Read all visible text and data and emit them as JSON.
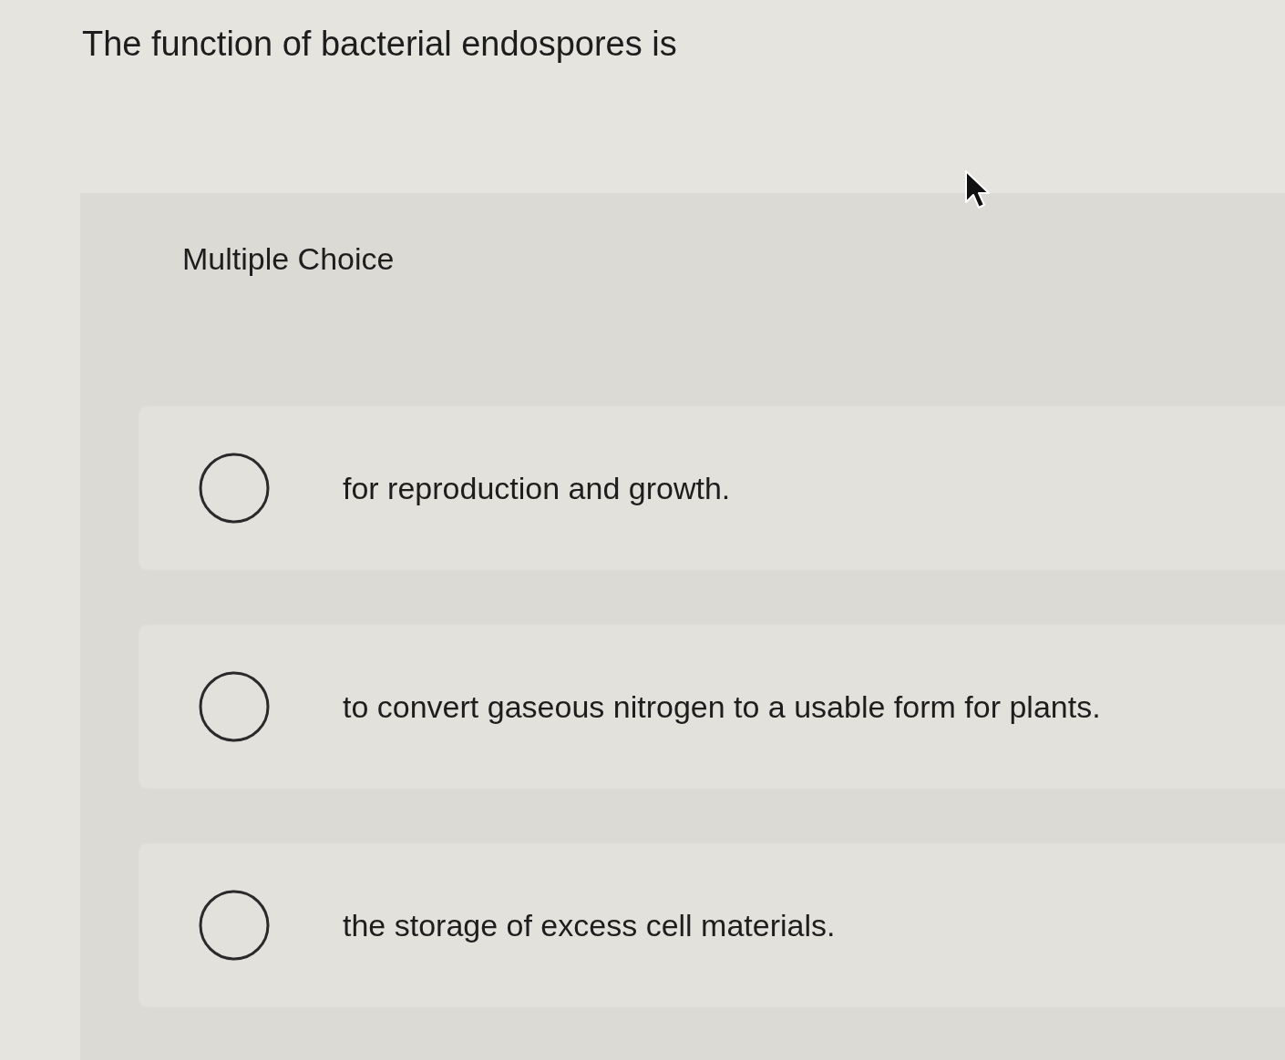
{
  "question": {
    "text": "The function of bacterial endospores is"
  },
  "answer_panel": {
    "heading": "Multiple Choice",
    "options": [
      {
        "text": "for reproduction and growth.",
        "selected": false
      },
      {
        "text": "to convert gaseous nitrogen to a usable form for plants.",
        "selected": false
      },
      {
        "text": "the storage of excess cell materials.",
        "selected": false
      }
    ]
  }
}
